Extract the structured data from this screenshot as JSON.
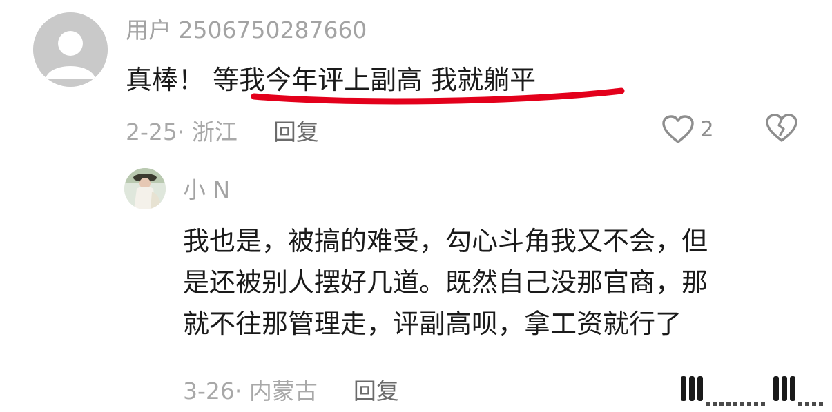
{
  "comment": {
    "username": "用户 2506750287660",
    "text": "真棒！ 等我今年评上副高 我就躺平",
    "date_location": "2-25· 浙江",
    "reply_label": "回复",
    "like_count": "2",
    "like_icon": "heart-outline-icon",
    "dislike_icon": "broken-heart-icon",
    "highlight_color": "#e3001b"
  },
  "reply": {
    "username": "小 N",
    "lines": [
      "我也是，被搞的难受，勾心斗角我又不会，但",
      "是还被别人摆好几道。既然自己没那官商，那",
      "就不往那管理走，评副高呗，拿工资就行了"
    ],
    "date_location": "3-26· 内蒙古",
    "reply_label": "回复"
  }
}
